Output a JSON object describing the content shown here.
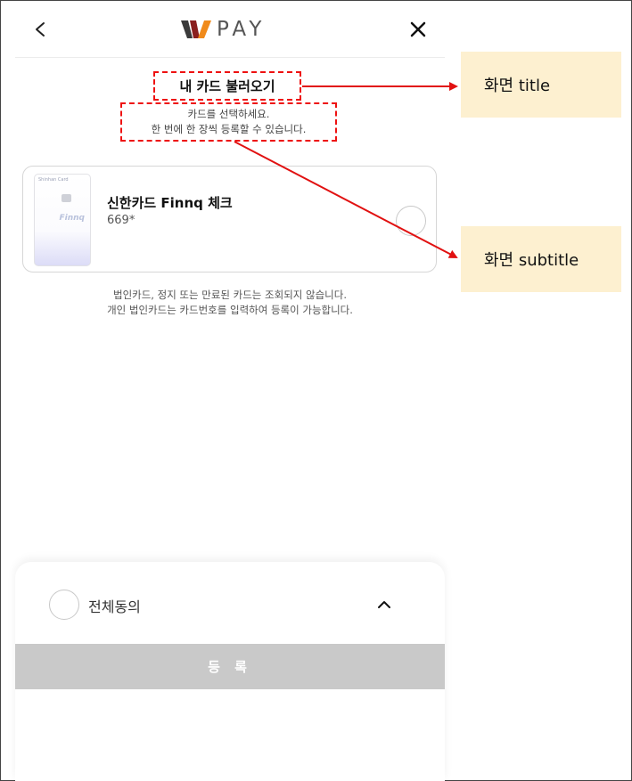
{
  "header": {
    "logo_text": "PAY",
    "logo_colors": {
      "w_left": "#3a3a3a",
      "w_mid": "#8a1f1f",
      "w_right": "#f08a1a"
    }
  },
  "page": {
    "title": "내 카드 불러오기",
    "subtitle_lines": [
      "카드를 선택하세요.",
      "한 번에 한 장씩 등록할 수 있습니다."
    ]
  },
  "card": {
    "name": "신한카드 Finnq 체크",
    "number": "669*",
    "brand_small": "Shinhan Card",
    "finnq_text": "Finnq"
  },
  "notice_lines": [
    "법인카드, 정지 또는 만료된 카드는 조회되지 않습니다.",
    "개인 법인카드는 카드번호를 입력하여 등록이 가능합니다."
  ],
  "agreement": {
    "label": "전체동의"
  },
  "register_button": {
    "label": "등 록"
  },
  "annotations": {
    "title_label": "화면  title",
    "subtitle_label": "화면 subtitle"
  },
  "colors": {
    "annotation_red": "#e11111",
    "annotation_box": "#fdf0d0",
    "register_disabled": "#c9c9c9"
  }
}
